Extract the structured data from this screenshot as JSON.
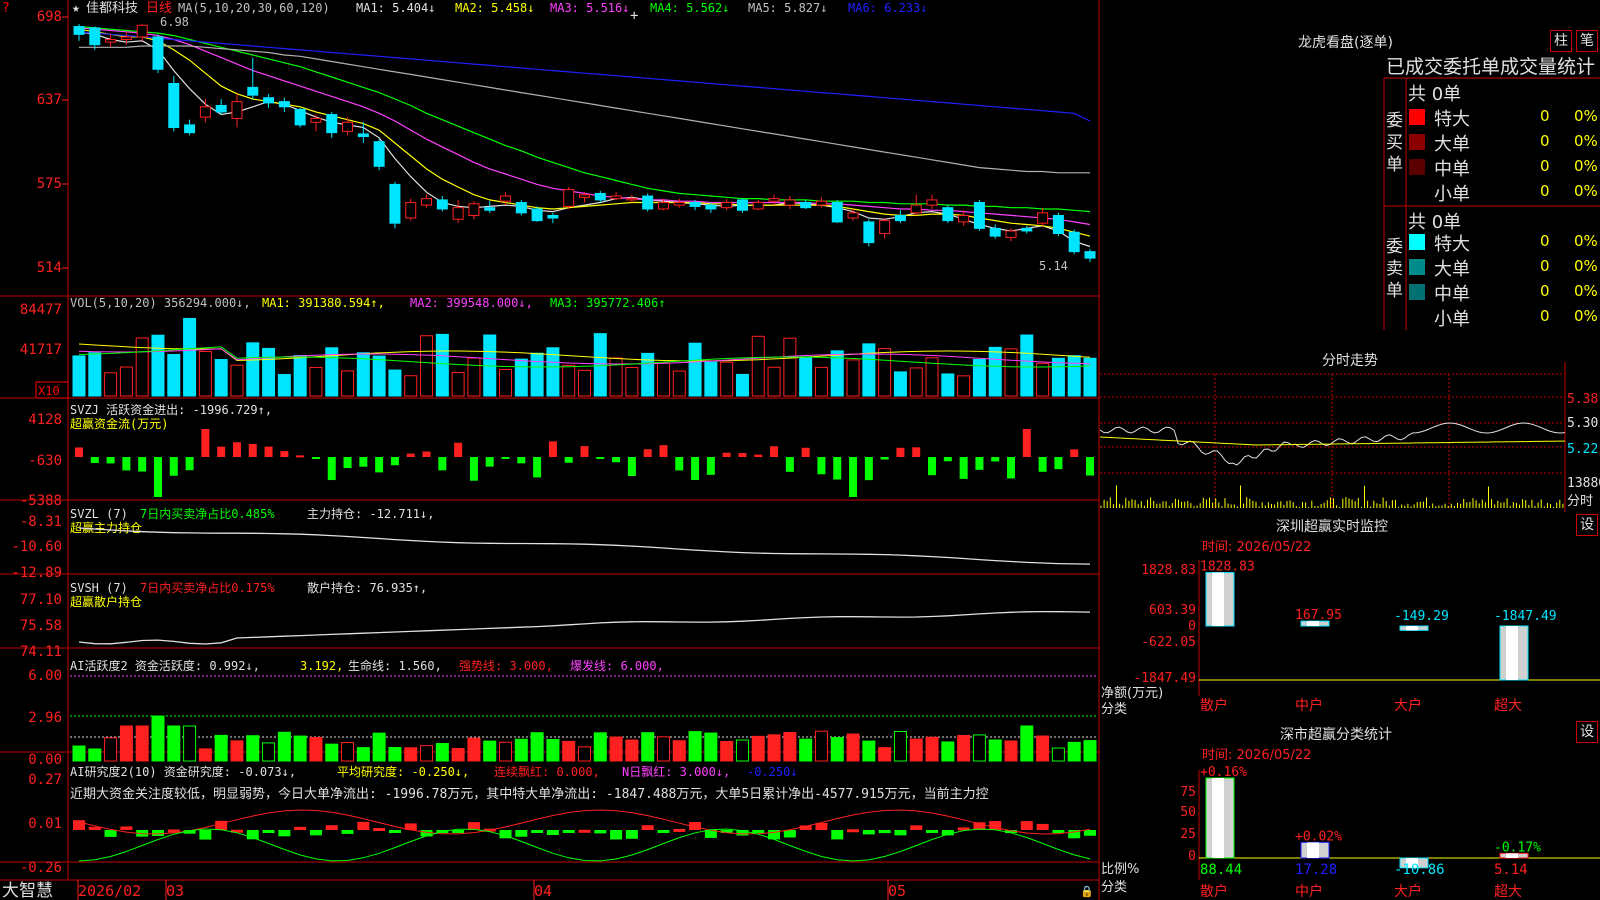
{
  "colors": {
    "bg": "#000000",
    "grid": "#c00000",
    "up": "#ff2020",
    "down": "#00e5ff",
    "yellow": "#ffff00",
    "magenta": "#ff40ff",
    "green": "#00ff00",
    "blue": "#2020ff",
    "white": "#e0e0e0"
  },
  "main": {
    "star": "★",
    "stock": "佳都科技",
    "period": "日线",
    "ma_header": "MA(5,10,20,30,60,120)",
    "ma1": "MA1: 5.404↓",
    "ma2": "MA2: 5.458↓",
    "ma3": "MA3: 5.516↓",
    "ma4": "MA4: 5.562↓",
    "ma5": "MA5: 5.827↓",
    "ma6": "MA6: 6.233↓",
    "high_label": "6.98",
    "low_label": "5.14",
    "y_labels": [
      "698",
      "637",
      "575",
      "514"
    ],
    "question": "?"
  },
  "vol": {
    "header": "VOL(5,10,20) 356294.000↓,",
    "ma1": "MA1: 391380.594↑,",
    "ma2": "MA2: 399548.000↓,",
    "ma3": "MA3: 395772.406↑",
    "y_labels": [
      "84477",
      "41717"
    ],
    "unit": "X10"
  },
  "svzj": {
    "header": "SVZJ  活跃资金进出: -1996.729↑,",
    "sub": "超赢资金流(万元)",
    "y_labels": [
      "4128",
      "-630",
      "-5388"
    ]
  },
  "svzl": {
    "prefix": "SVZL (7)",
    "ratio": "7日内买卖净占比0.485%",
    "value": "主力持仓: -12.711↓,",
    "sub": "超赢主力持仓",
    "y_labels": [
      "-8.31",
      "-10.60",
      "-12.89"
    ]
  },
  "svsh": {
    "prefix": "SVSH (7)",
    "ratio": "7日内买卖净占比0.175%",
    "value": "散户持仓: 76.935↑,",
    "sub": "超赢散户持仓",
    "y_labels": [
      "77.10",
      "75.58",
      "74.11"
    ]
  },
  "ai": {
    "header": "AI活跃度2 资金活跃度: 0.992↓,",
    "v2": "3.192,",
    "life": "生命线: 1.560,",
    "strong": "强势线: 3.000,",
    "burst": "爆发线: 6.000,",
    "y_labels": [
      "6.00",
      "2.96",
      "0.00"
    ]
  },
  "ai2": {
    "header": "AI研究度2(10) 资金研究度: -0.073↓,",
    "avg": "平均研究度: -0.250↓,",
    "cont": "连续飘红: 0.000,",
    "nday": "N日飘红: 3.000↓,",
    "tail": "-0.250↓",
    "text": "近期大资金关注度较低，明显弱势，今日大单净流出: -1996.78万元，其中特大单净流出: -1847.488万元，大单5日累计净出-4577.915万元，当前主力控",
    "y_labels": [
      "0.27",
      "0.01",
      "-0.26"
    ]
  },
  "xaxis": {
    "brand": "大智慧",
    "labels": [
      "2026/02",
      "03",
      "04",
      "05"
    ]
  },
  "dragon": {
    "title": "龙虎看盘(逐单)",
    "btn1": "柱",
    "btn2": "笔",
    "stat_title": "已成交委托单成交量统计",
    "buy": {
      "label": "委买单",
      "total": "共 0单",
      "rows": [
        {
          "name": "特大",
          "color": "#ff0000",
          "v": "0",
          "p": "0%"
        },
        {
          "name": "大单",
          "color": "#8b0000",
          "v": "0",
          "p": "0%"
        },
        {
          "name": "中单",
          "color": "#5a0000",
          "v": "0",
          "p": "0%"
        },
        {
          "name": "小单",
          "color": "#000000",
          "v": "0",
          "p": "0%"
        }
      ]
    },
    "sell": {
      "label": "委卖单",
      "total": "共 0单",
      "rows": [
        {
          "name": "特大",
          "color": "#00ffff",
          "v": "0",
          "p": "0%"
        },
        {
          "name": "大单",
          "color": "#008b8b",
          "v": "0",
          "p": "0%"
        },
        {
          "name": "中单",
          "color": "#007070",
          "v": "0",
          "p": "0%"
        },
        {
          "name": "小单",
          "color": "#000000",
          "v": "0",
          "p": "0%"
        }
      ]
    }
  },
  "intraday": {
    "title": "分时走势",
    "y_labels": [
      "5.38",
      "5.30",
      "5.22"
    ],
    "vol_label": "13880",
    "vol_unit": "分时"
  },
  "sz_monitor": {
    "title": "深圳超赢实时监控",
    "btn": "设",
    "time": "时间: 2026/05/22",
    "y_labels": [
      "1828.83",
      "603.39",
      "0",
      "-622.05",
      "-1847.49"
    ],
    "unit": "净额(万元)",
    "cat_label": "分类",
    "categories": [
      "散户",
      "中户",
      "大户",
      "超大"
    ],
    "values": [
      1828.83,
      167.95,
      -149.29,
      -1847.49
    ],
    "value_labels": [
      "1828.83",
      "167.95",
      "-149.29",
      "-1847.49"
    ]
  },
  "sz_class": {
    "title": "深市超赢分类统计",
    "btn": "设",
    "time": "时间: 2026/05/22",
    "y_labels": [
      "75",
      "50",
      "25",
      "0"
    ],
    "unit": "比例%",
    "cat_label": "分类",
    "categories": [
      "散户",
      "中户",
      "大户",
      "超大"
    ],
    "values": [
      88.44,
      17.28,
      -10.86,
      5.14
    ],
    "value_labels": [
      "88.44",
      "17.28",
      "-10.86",
      "5.14"
    ],
    "changes": [
      "+0.16%",
      "+0.02%",
      "",
      "-0.17%"
    ]
  },
  "chart_data": {
    "type": "candlestick",
    "x_labels": [
      "2026/02",
      "03",
      "04",
      "05"
    ],
    "price_ylim": [
      5.14,
      6.98
    ],
    "price_ticks": [
      6.98,
      6.37,
      5.75,
      5.14
    ],
    "candles": [
      {
        "o": 6.96,
        "c": 6.9,
        "h": 6.98,
        "l": 6.85
      },
      {
        "o": 6.95,
        "c": 6.82,
        "h": 6.96,
        "l": 6.78
      },
      {
        "o": 6.84,
        "c": 6.86,
        "h": 6.9,
        "l": 6.8
      },
      {
        "o": 6.86,
        "c": 6.88,
        "h": 6.92,
        "l": 6.82
      },
      {
        "o": 6.88,
        "c": 6.97,
        "h": 6.98,
        "l": 6.85
      },
      {
        "o": 6.88,
        "c": 6.63,
        "h": 6.9,
        "l": 6.6
      },
      {
        "o": 6.52,
        "c": 6.18,
        "h": 6.58,
        "l": 6.15
      },
      {
        "o": 6.2,
        "c": 6.14,
        "h": 6.24,
        "l": 6.12
      },
      {
        "o": 6.26,
        "c": 6.34,
        "h": 6.4,
        "l": 6.22
      },
      {
        "o": 6.35,
        "c": 6.3,
        "h": 6.4,
        "l": 6.28
      },
      {
        "o": 6.25,
        "c": 6.38,
        "h": 6.44,
        "l": 6.18
      },
      {
        "o": 6.49,
        "c": 6.43,
        "h": 6.72,
        "l": 6.4
      },
      {
        "o": 6.41,
        "c": 6.37,
        "h": 6.44,
        "l": 6.33
      },
      {
        "o": 6.38,
        "c": 6.34,
        "h": 6.41,
        "l": 6.3
      },
      {
        "o": 6.32,
        "c": 6.2,
        "h": 6.33,
        "l": 6.18
      },
      {
        "o": 6.22,
        "c": 6.25,
        "h": 6.28,
        "l": 6.15
      },
      {
        "o": 6.28,
        "c": 6.14,
        "h": 6.3,
        "l": 6.1
      },
      {
        "o": 6.15,
        "c": 6.22,
        "h": 6.26,
        "l": 6.12
      },
      {
        "o": 6.13,
        "c": 6.11,
        "h": 6.22,
        "l": 6.06
      },
      {
        "o": 6.07,
        "c": 5.88,
        "h": 6.09,
        "l": 5.85
      },
      {
        "o": 5.74,
        "c": 5.44,
        "h": 5.76,
        "l": 5.4
      },
      {
        "o": 5.48,
        "c": 5.6,
        "h": 5.63,
        "l": 5.46
      },
      {
        "o": 5.58,
        "c": 5.63,
        "h": 5.66,
        "l": 5.56
      },
      {
        "o": 5.62,
        "c": 5.55,
        "h": 5.65,
        "l": 5.53
      },
      {
        "o": 5.47,
        "c": 5.56,
        "h": 5.62,
        "l": 5.44
      },
      {
        "o": 5.5,
        "c": 5.59,
        "h": 5.61,
        "l": 5.47
      },
      {
        "o": 5.56,
        "c": 5.54,
        "h": 5.61,
        "l": 5.52
      },
      {
        "o": 5.61,
        "c": 5.65,
        "h": 5.68,
        "l": 5.58
      },
      {
        "o": 5.6,
        "c": 5.52,
        "h": 5.62,
        "l": 5.5
      },
      {
        "o": 5.55,
        "c": 5.46,
        "h": 5.57,
        "l": 5.45
      },
      {
        "o": 5.5,
        "c": 5.48,
        "h": 5.52,
        "l": 5.44
      },
      {
        "o": 5.57,
        "c": 5.7,
        "h": 5.72,
        "l": 5.55
      },
      {
        "o": 5.64,
        "c": 5.66,
        "h": 5.68,
        "l": 5.6
      },
      {
        "o": 5.67,
        "c": 5.62,
        "h": 5.69,
        "l": 5.6
      },
      {
        "o": 5.63,
        "c": 5.65,
        "h": 5.68,
        "l": 5.62
      },
      {
        "o": 5.62,
        "c": 5.63,
        "h": 5.66,
        "l": 5.6
      },
      {
        "o": 5.65,
        "c": 5.55,
        "h": 5.67,
        "l": 5.53
      },
      {
        "o": 5.55,
        "c": 5.6,
        "h": 5.63,
        "l": 5.54
      },
      {
        "o": 5.58,
        "c": 5.6,
        "h": 5.63,
        "l": 5.56
      },
      {
        "o": 5.6,
        "c": 5.57,
        "h": 5.62,
        "l": 5.54
      },
      {
        "o": 5.58,
        "c": 5.55,
        "h": 5.6,
        "l": 5.52
      },
      {
        "o": 5.56,
        "c": 5.6,
        "h": 5.63,
        "l": 5.54
      },
      {
        "o": 5.62,
        "c": 5.54,
        "h": 5.63,
        "l": 5.52
      },
      {
        "o": 5.55,
        "c": 5.6,
        "h": 5.62,
        "l": 5.54
      },
      {
        "o": 5.61,
        "c": 5.63,
        "h": 5.66,
        "l": 5.58
      },
      {
        "o": 5.58,
        "c": 5.62,
        "h": 5.65,
        "l": 5.55
      },
      {
        "o": 5.6,
        "c": 5.56,
        "h": 5.62,
        "l": 5.55
      },
      {
        "o": 5.58,
        "c": 5.61,
        "h": 5.64,
        "l": 5.56
      },
      {
        "o": 5.6,
        "c": 5.45,
        "h": 5.62,
        "l": 5.44
      },
      {
        "o": 5.48,
        "c": 5.52,
        "h": 5.55,
        "l": 5.46
      },
      {
        "o": 5.45,
        "c": 5.29,
        "h": 5.47,
        "l": 5.26
      },
      {
        "o": 5.36,
        "c": 5.46,
        "h": 5.48,
        "l": 5.32
      },
      {
        "o": 5.5,
        "c": 5.46,
        "h": 5.54,
        "l": 5.44
      },
      {
        "o": 5.52,
        "c": 5.58,
        "h": 5.66,
        "l": 5.5
      },
      {
        "o": 5.58,
        "c": 5.62,
        "h": 5.66,
        "l": 5.55
      },
      {
        "o": 5.56,
        "c": 5.46,
        "h": 5.58,
        "l": 5.44
      },
      {
        "o": 5.45,
        "c": 5.5,
        "h": 5.54,
        "l": 5.42
      },
      {
        "o": 5.6,
        "c": 5.4,
        "h": 5.62,
        "l": 5.38
      },
      {
        "o": 5.4,
        "c": 5.34,
        "h": 5.43,
        "l": 5.32
      },
      {
        "o": 5.33,
        "c": 5.38,
        "h": 5.4,
        "l": 5.3
      },
      {
        "o": 5.4,
        "c": 5.38,
        "h": 5.42,
        "l": 5.36
      },
      {
        "o": 5.44,
        "c": 5.52,
        "h": 5.56,
        "l": 5.42
      },
      {
        "o": 5.5,
        "c": 5.36,
        "h": 5.52,
        "l": 5.34
      },
      {
        "o": 5.37,
        "c": 5.22,
        "h": 5.39,
        "l": 5.2
      },
      {
        "o": 5.22,
        "c": 5.17,
        "h": 5.24,
        "l": 5.14
      }
    ],
    "ma_series": [
      {
        "name": "MA1",
        "color": "#e0e0e0",
        "values": [
          6.92,
          6.9,
          6.86,
          6.84,
          6.85,
          6.78,
          6.62,
          6.48,
          6.36,
          6.28,
          6.3,
          6.34,
          6.38,
          6.36,
          6.31,
          6.26,
          6.22,
          6.2,
          6.18,
          6.1,
          5.94,
          5.8,
          5.68,
          5.6,
          5.57,
          5.56,
          5.57,
          5.58,
          5.57,
          5.54,
          5.53,
          5.56,
          5.58,
          5.6,
          5.63,
          5.64,
          5.62,
          5.61,
          5.6,
          5.59,
          5.58,
          5.57,
          5.58,
          5.58,
          5.58,
          5.6,
          5.59,
          5.58,
          5.56,
          5.53,
          5.48,
          5.47,
          5.49,
          5.52,
          5.53,
          5.51,
          5.47,
          5.43,
          5.4,
          5.38,
          5.4,
          5.42,
          5.38,
          5.3,
          5.26
        ]
      },
      {
        "name": "MA2",
        "color": "#ffff00",
        "values": [
          6.94,
          6.92,
          6.9,
          6.88,
          6.88,
          6.85,
          6.78,
          6.7,
          6.6,
          6.5,
          6.44,
          6.4,
          6.38,
          6.36,
          6.34,
          6.3,
          6.27,
          6.24,
          6.21,
          6.16,
          6.06,
          5.96,
          5.86,
          5.78,
          5.72,
          5.66,
          5.62,
          5.6,
          5.58,
          5.56,
          5.55,
          5.56,
          5.57,
          5.58,
          5.59,
          5.6,
          5.6,
          5.6,
          5.6,
          5.6,
          5.59,
          5.59,
          5.58,
          5.58,
          5.58,
          5.58,
          5.58,
          5.58,
          5.57,
          5.55,
          5.53,
          5.51,
          5.5,
          5.5,
          5.51,
          5.51,
          5.5,
          5.48,
          5.46,
          5.44,
          5.43,
          5.42,
          5.4,
          5.37,
          5.34
        ]
      },
      {
        "name": "MA3",
        "color": "#ff40ff",
        "values": [
          6.95,
          6.94,
          6.93,
          6.92,
          6.91,
          6.89,
          6.86,
          6.82,
          6.77,
          6.72,
          6.67,
          6.62,
          6.58,
          6.54,
          6.5,
          6.46,
          6.42,
          6.38,
          6.34,
          6.29,
          6.23,
          6.16,
          6.09,
          6.03,
          5.97,
          5.91,
          5.86,
          5.82,
          5.78,
          5.74,
          5.71,
          5.69,
          5.67,
          5.65,
          5.64,
          5.63,
          5.62,
          5.62,
          5.61,
          5.61,
          5.6,
          5.6,
          5.6,
          5.6,
          5.6,
          5.6,
          5.6,
          5.59,
          5.59,
          5.58,
          5.57,
          5.56,
          5.55,
          5.55,
          5.54,
          5.54,
          5.53,
          5.52,
          5.51,
          5.5,
          5.49,
          5.48,
          5.47,
          5.45,
          5.43
        ]
      },
      {
        "name": "MA4",
        "color": "#00ff00",
        "values": [
          6.96,
          6.95,
          6.94,
          6.93,
          6.92,
          6.91,
          6.89,
          6.86,
          6.83,
          6.8,
          6.77,
          6.74,
          6.71,
          6.68,
          6.65,
          6.61,
          6.57,
          6.53,
          6.49,
          6.45,
          6.4,
          6.35,
          6.29,
          6.24,
          6.19,
          6.14,
          6.09,
          6.04,
          6.0,
          5.95,
          5.91,
          5.87,
          5.83,
          5.8,
          5.77,
          5.74,
          5.71,
          5.69,
          5.67,
          5.66,
          5.65,
          5.64,
          5.63,
          5.63,
          5.62,
          5.62,
          5.62,
          5.61,
          5.61,
          5.61,
          5.6,
          5.6,
          5.59,
          5.59,
          5.59,
          5.58,
          5.58,
          5.57,
          5.57,
          5.56,
          5.56,
          5.55,
          5.55,
          5.54,
          5.53
        ]
      },
      {
        "name": "MA5",
        "color": "#b0b0b0",
        "values": [
          6.8,
          6.8,
          6.8,
          6.8,
          6.81,
          6.81,
          6.81,
          6.81,
          6.8,
          6.79,
          6.78,
          6.77,
          6.76,
          6.74,
          6.73,
          6.71,
          6.69,
          6.67,
          6.65,
          6.63,
          6.61,
          6.59,
          6.57,
          6.55,
          6.53,
          6.51,
          6.49,
          6.47,
          6.45,
          6.43,
          6.41,
          6.39,
          6.37,
          6.35,
          6.33,
          6.31,
          6.29,
          6.27,
          6.25,
          6.23,
          6.21,
          6.19,
          6.17,
          6.15,
          6.13,
          6.11,
          6.09,
          6.07,
          6.05,
          6.03,
          6.01,
          5.99,
          5.97,
          5.95,
          5.93,
          5.91,
          5.89,
          5.87,
          5.86,
          5.85,
          5.84,
          5.84,
          5.83,
          5.83,
          5.83
        ]
      },
      {
        "name": "MA6",
        "color": "#2020ff",
        "values": [
          6.92,
          6.91,
          6.9,
          6.89,
          6.88,
          6.87,
          6.86,
          6.85,
          6.84,
          6.83,
          6.82,
          6.81,
          6.8,
          6.79,
          6.78,
          6.77,
          6.76,
          6.75,
          6.74,
          6.73,
          6.72,
          6.71,
          6.7,
          6.69,
          6.68,
          6.67,
          6.66,
          6.65,
          6.64,
          6.63,
          6.62,
          6.61,
          6.6,
          6.59,
          6.58,
          6.57,
          6.56,
          6.55,
          6.54,
          6.53,
          6.52,
          6.51,
          6.5,
          6.49,
          6.48,
          6.47,
          6.46,
          6.45,
          6.44,
          6.43,
          6.42,
          6.41,
          6.4,
          6.39,
          6.38,
          6.37,
          6.36,
          6.35,
          6.34,
          6.33,
          6.32,
          6.31,
          6.3,
          6.29,
          6.23
        ]
      }
    ]
  }
}
